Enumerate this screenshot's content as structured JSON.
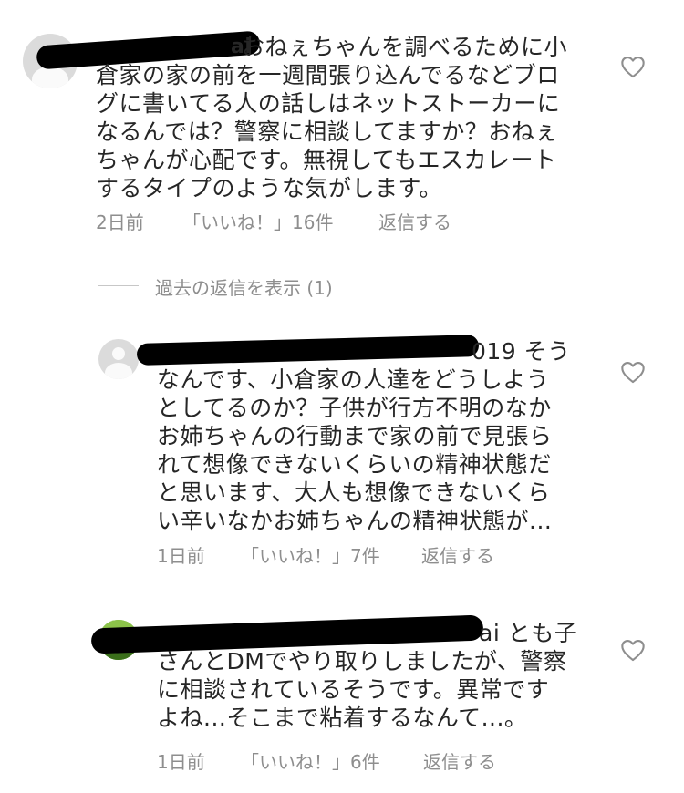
{
  "comments": [
    {
      "handle_visible": "ai",
      "text": "おねぇちゃんを調べるために小倉家の家の前を一週間張り込んでるなどブログに書いてる人の話しはネットストーカーになるんでは？警察に相談してますか？おねぇちゃんが心配です。無視してもエスカレートするタイプのような気がします。",
      "lines": [
        "おねぇちゃんを調べるために小",
        "倉家の家の前を一週間張り込んでるなどブロ",
        "グに書いてる人の話しはネットストーカーに",
        "なるんでは？警察に相談してますか？おねぇ",
        "ちゃんが心配です。無視してもエスカレート",
        "するタイプのような気がします。"
      ],
      "time": "2日前",
      "likes": "「いいね！」16件",
      "reply": "返信する"
    },
    {
      "handle_visible": "019",
      "lines": [
        "019 そう",
        "なんです、小倉家の人達をどうしよう",
        "としてるのか？子供が行方不明のなか",
        "お姉ちゃんの行動まで家の前で見張ら",
        "れて想像できないくらいの精神状態だ",
        "と思います、大人も想像できないくら",
        "い辛いなかお姉ちゃんの精神状態が..."
      ],
      "time": "1日前",
      "likes": "「いいね！」7件",
      "reply": "返信する"
    },
    {
      "handle_visible": "ai",
      "lines": [
        "ai とも子",
        "さんとDMでやり取りしましたが、警察",
        "に相談されているそうです。異常です",
        "よね...そこまで粘着するなんて...。"
      ],
      "time": "1日前",
      "likes": "「いいね！」6件",
      "reply": "返信する"
    }
  ],
  "view_replies": "過去の返信を表示 (1)",
  "colors": {
    "text": "#262626",
    "meta": "#8e8e8e",
    "line": "#c7c7c7"
  },
  "icons": {
    "like": "heart-outline-icon",
    "avatar": "default-avatar-icon"
  }
}
